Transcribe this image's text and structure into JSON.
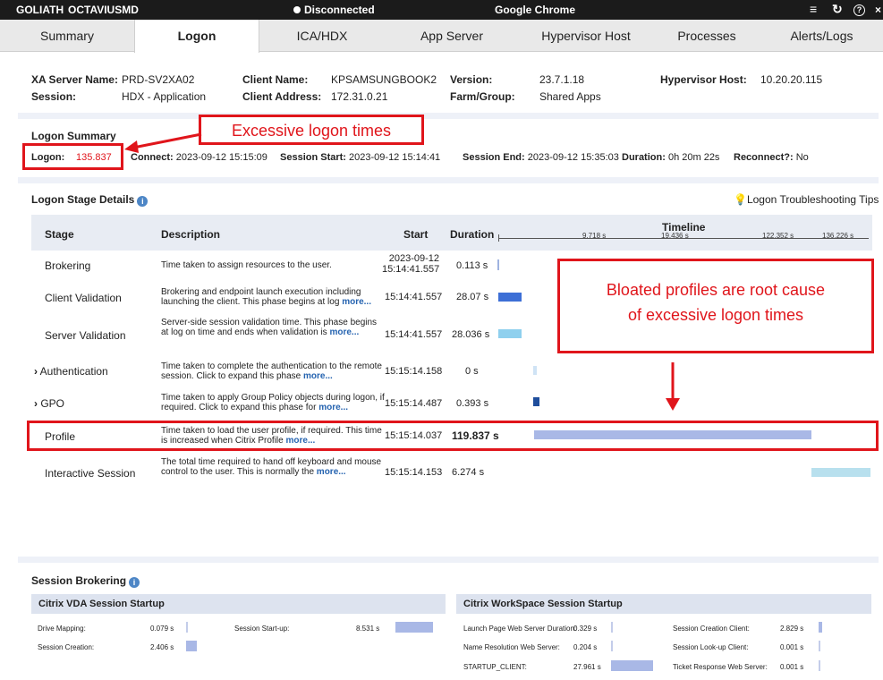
{
  "titlebar": {
    "user": "GOLIATH",
    "machine": "OCTAVIUSMD",
    "status": "Disconnected",
    "app": "Google Chrome"
  },
  "tabs": [
    "Summary",
    "Logon",
    "ICA/HDX",
    "App Server",
    "Hypervisor Host",
    "Processes",
    "Alerts/Logs"
  ],
  "active_tab": "Logon",
  "server_info": {
    "xa_server_label": "XA Server Name:",
    "xa_server_value": "PRD-SV2XA02",
    "session_label": "Session:",
    "session_value": "HDX - Application",
    "client_name_label": "Client Name:",
    "client_name_value": "KPSAMSUNGBOOK2",
    "client_address_label": "Client Address:",
    "client_address_value": "172.31.0.21",
    "version_label": "Version:",
    "version_value": "23.7.1.18",
    "farm_label": "Farm/Group:",
    "farm_value": "Shared Apps",
    "hypervisor_label": "Hypervisor Host:",
    "hypervisor_value": "10.20.20.115"
  },
  "logon_summary": {
    "title": "Logon Summary",
    "logon_label": "Logon:",
    "logon_value": "135.837",
    "connect_label": "Connect:",
    "connect_value": "2023-09-12 15:15:09",
    "session_start_label": "Session Start:",
    "session_start_value": "2023-09-12 15:14:41",
    "session_end_label": "Session End:",
    "session_end_value": "2023-09-12 15:35:03",
    "duration_label": "Duration:",
    "duration_value": "0h 20m 22s",
    "reconnect_label": "Reconnect?:",
    "reconnect_value": "No"
  },
  "stage_details": {
    "title": "Logon Stage Details",
    "tips": "Logon Troubleshooting Tips",
    "headers": {
      "stage": "Stage",
      "description": "Description",
      "start": "Start",
      "duration": "Duration",
      "timeline": "Timeline"
    },
    "timeline_ticks": [
      "9.718 s",
      "19.436 s",
      "122.352 s",
      "136.226 s"
    ],
    "rows": [
      {
        "stage": "Brokering",
        "desc": "Time taken to assign resources to the user.",
        "more": "",
        "start": "2023-09-12 15:14:41.557",
        "duration": "0.113 s"
      },
      {
        "stage": "Client Validation",
        "desc": "Brokering and endpoint launch execution including launching the client. This phase begins at log",
        "more": "more...",
        "start": "15:14:41.557",
        "duration": "28.07 s"
      },
      {
        "stage": "Server Validation",
        "desc": "Server-side session validation time. This phase begins at log on time and ends when validation is",
        "more": "more...",
        "start": "15:14:41.557",
        "duration": "28.036 s"
      },
      {
        "stage": "Authentication",
        "desc": "Time taken to complete the authentication to the remote session. Click to expand this phase",
        "more": "more...",
        "start": "15:15:14.158",
        "duration": "0 s"
      },
      {
        "stage": "GPO",
        "desc": "Time taken to apply Group Policy objects during logon, if required. Click to expand this phase for",
        "more": "more...",
        "start": "15:15:14.487",
        "duration": "0.393 s"
      },
      {
        "stage": "Profile",
        "desc": "Time taken to load the user profile, if required. This time is increased when Citrix Profile",
        "more": "more...",
        "start": "15:15:14.037",
        "duration": "119.837 s"
      },
      {
        "stage": "Interactive Session",
        "desc": "The total time required to hand off keyboard and mouse control to the user. This is normally the",
        "more": "more...",
        "start": "15:15:14.153",
        "duration": "6.274 s"
      }
    ]
  },
  "annotations": {
    "excessive": "Excessive logon times",
    "bloated_line1": "Bloated profiles are root cause",
    "bloated_line2": "of excessive logon times"
  },
  "session_brokering": {
    "title": "Session Brokering",
    "vda_title": "Citrix VDA Session Startup",
    "workspace_title": "Citrix WorkSpace Session Startup",
    "vda_items": [
      {
        "label": "Drive Mapping:",
        "value": "0.079 s"
      },
      {
        "label": "Session Creation:",
        "value": "2.406 s"
      },
      {
        "label": "Session Start-up:",
        "value": "8.531 s"
      }
    ],
    "ws_items": [
      {
        "label": "Launch Page Web Server Duration:",
        "value": "0.329 s"
      },
      {
        "label": "Name Resolution Web Server:",
        "value": "0.204 s"
      },
      {
        "label": "STARTUP_CLIENT:",
        "value": "27.961 s"
      },
      {
        "label": "Session Creation Client:",
        "value": "2.829 s"
      },
      {
        "label": "Session Look-up Client:",
        "value": "0.001 s"
      },
      {
        "label": "Ticket Response Web Server:",
        "value": "0.001 s"
      }
    ]
  },
  "colors": {
    "accent_red": "#e0151b",
    "bar_dark": "#3d6fd6",
    "bar_light": "#8fd0ee",
    "bar_profile": "#a9b8e6",
    "logon_value": "#e0151b"
  }
}
